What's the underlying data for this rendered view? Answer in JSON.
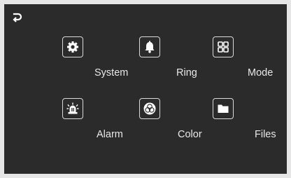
{
  "back": {
    "icon": "back-arrow-icon"
  },
  "menu": [
    {
      "id": "system",
      "label": "System",
      "icon": "gear-icon"
    },
    {
      "id": "ring",
      "label": "Ring",
      "icon": "bell-icon"
    },
    {
      "id": "mode",
      "label": "Mode",
      "icon": "grid-icon"
    },
    {
      "id": "alarm",
      "label": "Alarm",
      "icon": "siren-icon"
    },
    {
      "id": "color",
      "label": "Color",
      "icon": "color-circles-icon"
    },
    {
      "id": "files",
      "label": "Files",
      "icon": "folder-icon"
    }
  ],
  "colors": {
    "screen_bg": "#2b2b2b",
    "icon_fg": "#ffffff",
    "text": "#e8e8e8"
  }
}
